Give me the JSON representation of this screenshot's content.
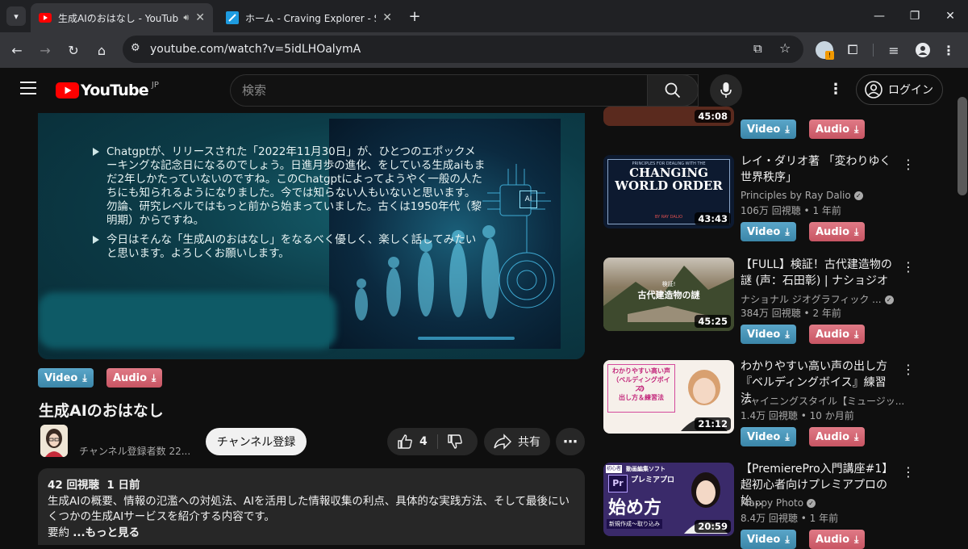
{
  "browser": {
    "tabs": [
      {
        "title": "生成AIのおはなし - YouTube",
        "active": true
      },
      {
        "title": "ホーム - Craving Explorer - Start",
        "active": false
      }
    ],
    "url": "youtube.com/watch?v=5idLHOalymA"
  },
  "header": {
    "logo_text": "YouTube",
    "region": "JP",
    "search_placeholder": "検索",
    "login_label": "ログイン"
  },
  "slide": {
    "bullets": [
      "Chatgptが、リリースされた「2022年11月30日」が、ひとつのエポックメーキングな記念日になるのでしょう。日進月歩の進化、をしている生成aiもまだ2年しかたっていないのですね。このChatgptによってようやく一般の人たちにも知られるようになりました。今では知らない人もいないと思います。勿論、研究レベルではもっと前から始まっていました。古くは1950年代（黎明期）からですね。",
      "今日はそんな「生成AIのおはなし」をなるべく優しく、楽しく話してみたいと思います。よろしくお願いします。"
    ],
    "ai_chip_label": "AI"
  },
  "downloads": {
    "video_label": "Video",
    "audio_label": "Audio"
  },
  "video": {
    "title": "生成AIのおはなし",
    "subscribers": "チャンネル登録者数 22...",
    "subscribe_label": "チャンネル登録",
    "likes": "4",
    "share_label": "共有",
    "views": "42 回視聴",
    "age": "1 日前",
    "description": "生成AIの概要、情報の氾濫への対処法、AIを活用した情報収集の利点、具体的な実践方法、そして最後にいくつかの生成AIサービスを紹介する内容です。",
    "summary_prefix": "要約",
    "more_label": "...もっと見る"
  },
  "related": [
    {
      "duration": "45:08"
    },
    {
      "title": "レイ・ダリオ著 「変わりゆく世界秩序」",
      "channel": "Principles by Ray Dalio",
      "verified": true,
      "views": "106万 回視聴",
      "age": "1 年前",
      "duration": "43:43",
      "thumb_text": [
        "PRINCIPLES FOR DEALING WITH THE",
        "CHANGING",
        "WORLD ORDER",
        "BY RAY DALIO"
      ]
    },
    {
      "title": "【FULL】検証！古代建造物の謎 (声：石田彰) | ナショジオ",
      "channel": "ナショナル ジオグラフィック ...",
      "verified": true,
      "views": "384万 回視聴",
      "age": "2 年前",
      "duration": "45:25",
      "thumb_text": [
        "検証!",
        "古代建造物の謎"
      ]
    },
    {
      "title": "わかりやすい高い声の出し方『ベルディングボイス』練習法",
      "channel": "シャイニングスタイル【ミュージッ...",
      "verified": false,
      "views": "1.4万 回視聴",
      "age": "10 か月前",
      "duration": "21:12",
      "thumb_text": [
        "わかりやすい高い声",
        "（ベルディングボイス）",
        "の",
        "出し方＆練習法"
      ]
    },
    {
      "title": "【PremierePro入門講座#1】超初心者向けプレミアプロの始...",
      "channel": "Mappy Photo",
      "verified": true,
      "views": "8.4万 回視聴",
      "age": "1 年前",
      "duration": "20:59",
      "thumb_text": [
        "初心者",
        "動画編集ソフト",
        "プレミアプロ",
        "Pr",
        "始め方",
        "新規作成〜取り込み"
      ]
    }
  ]
}
